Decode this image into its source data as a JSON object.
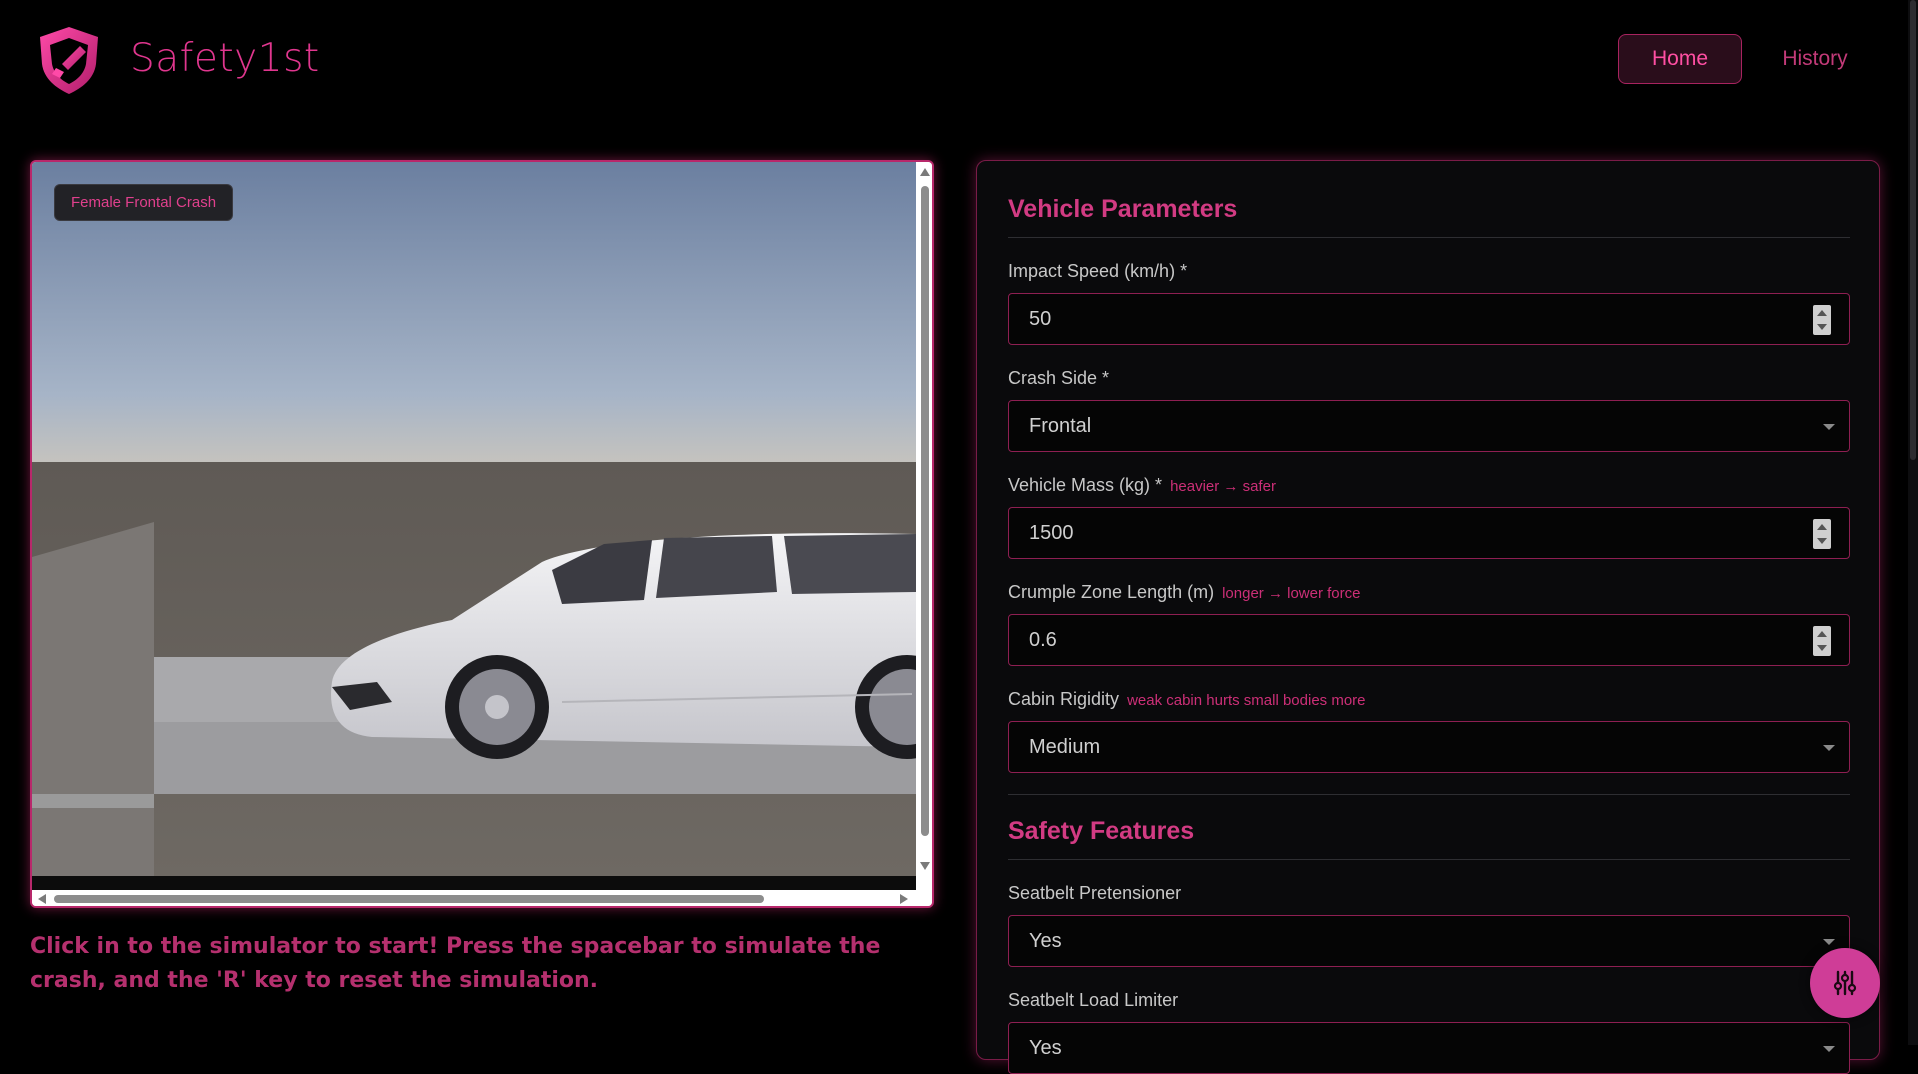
{
  "header": {
    "brand": "Safety1st",
    "nav": {
      "home": "Home",
      "history": "History"
    }
  },
  "simulator": {
    "badge": "Female Frontal Crash",
    "instructions": "Click in to the simulator to start! Press the spacebar to simulate the crash, and the 'R' key to reset the simulation."
  },
  "vehicle": {
    "title": "Vehicle Parameters",
    "impact_speed": {
      "label": "Impact Speed (km/h) *",
      "value": "50"
    },
    "crash_side": {
      "label": "Crash Side *",
      "value": "Frontal"
    },
    "mass": {
      "label": "Vehicle Mass (kg) *",
      "hint": "heavier → safer",
      "value": "1500"
    },
    "crumple": {
      "label": "Crumple Zone Length (m)",
      "hint": "longer → lower force",
      "value": "0.6"
    },
    "rigidity": {
      "label": "Cabin Rigidity",
      "hint": "weak cabin hurts small bodies more",
      "value": "Medium"
    }
  },
  "safety": {
    "title": "Safety Features",
    "pretensioner": {
      "label": "Seatbelt Pretensioner",
      "value": "Yes"
    },
    "load_limiter": {
      "label": "Seatbelt Load Limiter",
      "value": "Yes"
    }
  },
  "icons": {
    "logo": "shield-brush-icon",
    "fab": "sliders-icon"
  },
  "colors": {
    "accent": "#e0368e",
    "section_title": "#d23b83",
    "instruction_text": "#b5306e",
    "fab_bg": "#cf3d97",
    "background": "#000000"
  }
}
